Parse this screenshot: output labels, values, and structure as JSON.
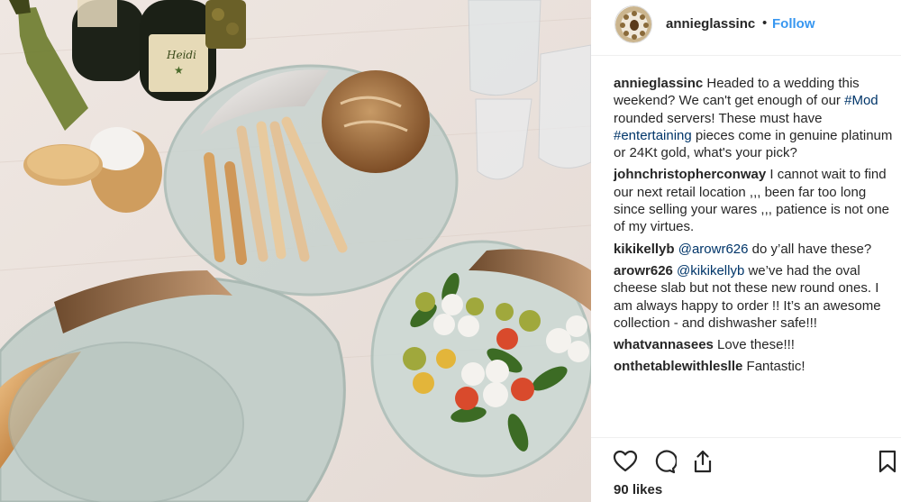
{
  "post": {
    "username": "annieglassinc",
    "separator": "•",
    "follow_label": "Follow",
    "likes": "90 likes"
  },
  "comments": [
    {
      "user": "annieglassinc",
      "parts": [
        {
          "t": "text",
          "v": " Headed to a wedding this weekend? We can't get enough of our "
        },
        {
          "t": "tag",
          "v": "#Mod"
        },
        {
          "t": "text",
          "v": " rounded servers! These must have "
        },
        {
          "t": "tag",
          "v": "#entertaining"
        },
        {
          "t": "text",
          "v": " pieces come in genuine platinum or 24Kt gold, what's your pick?"
        }
      ]
    },
    {
      "user": "johnchristopherconway",
      "parts": [
        {
          "t": "text",
          "v": " I cannot wait to find our next retail location ,,, been far too long since selling your wares ,,, patience is not one of my virtues."
        }
      ]
    },
    {
      "user": "kikikellyb",
      "parts": [
        {
          "t": "text",
          "v": " "
        },
        {
          "t": "mention",
          "v": "@arowr626"
        },
        {
          "t": "text",
          "v": " do y’all have these?"
        }
      ]
    },
    {
      "user": "arowr626",
      "parts": [
        {
          "t": "text",
          "v": " "
        },
        {
          "t": "mention",
          "v": "@kikikellyb"
        },
        {
          "t": "text",
          "v": " we’ve had the oval cheese slab but not these new round ones. I am always happy to order !! It’s an awesome collection - and dishwasher safe!!!"
        }
      ]
    },
    {
      "user": "whatvannasees",
      "parts": [
        {
          "t": "text",
          "v": " Love these!!!"
        }
      ]
    },
    {
      "user": "onthetablewithleslle",
      "parts": [
        {
          "t": "text",
          "v": " Fantastic!"
        }
      ]
    }
  ],
  "icons": {
    "like": "heart-icon",
    "comment": "comment-icon",
    "share": "share-icon",
    "save": "bookmark-icon"
  },
  "colors": {
    "link": "#3897f0",
    "hashtag": "#003569",
    "text": "#262626"
  }
}
